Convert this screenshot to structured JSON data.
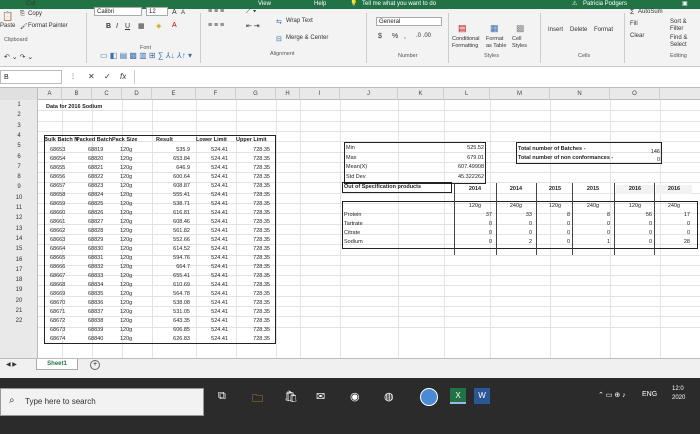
{
  "ribbon": {
    "tabs": [
      "View",
      "Help",
      "Tell me what you want to do"
    ],
    "user": "Patricia Podgers",
    "clipboard": {
      "cut": "Cut",
      "copy": "Copy",
      "paste": "Paste",
      "format_painter": "Format Painter",
      "label": "Clipboard"
    },
    "font": {
      "name": "Calibri",
      "size": "12",
      "label": "Font",
      "grow": "A",
      "shrink": "A",
      "bold": "B",
      "italic": "I",
      "underline": "U"
    },
    "alignment": {
      "wrap": "Wrap Text",
      "merge": "Merge & Center",
      "label": "Alignment"
    },
    "number": {
      "format": "General",
      "currency": "$",
      "percent": "%",
      "comma": ",",
      "label": "Number"
    },
    "styles": {
      "conditional": "Conditional Formatting",
      "format_table": "Format as Table",
      "cell_styles": "Cell Styles",
      "label": "Styles"
    },
    "cells": {
      "insert": "Insert",
      "delete": "Delete",
      "format": "Format",
      "label": "Cells"
    },
    "editing": {
      "autosum": "AutoSum",
      "fill": "Fill",
      "clear": "Clear",
      "sort": "Sort & Filter",
      "find": "Find & Select",
      "label": "Editing"
    }
  },
  "formula_bar": {
    "name_box": "B",
    "cancel": "✕",
    "enter": "✓",
    "fx": "fx",
    "value": ""
  },
  "columns": [
    "A",
    "B",
    "C",
    "D",
    "E",
    "F",
    "G",
    "H",
    "I",
    "J",
    "K",
    "L",
    "M",
    "N",
    "O"
  ],
  "rows": [
    "1",
    "2",
    "3",
    "4",
    "5",
    "6",
    "7",
    "8",
    "9",
    "10",
    "11",
    "12",
    "13",
    "14",
    "15",
    "16",
    "17",
    "18",
    "19",
    "20",
    "21",
    "22"
  ],
  "sheet": {
    "title": "Data for 2016 Sodium",
    "headers": [
      "Bulk Batch No.",
      "Packed Batch",
      "Pack Size",
      "Result",
      "Lower Limit",
      "Upper Limit"
    ],
    "bulk_batch": [
      "68653",
      "68654",
      "68655",
      "68656",
      "68657",
      "68658",
      "68659",
      "68660",
      "68661",
      "68662",
      "68663",
      "68664",
      "68665",
      "68666",
      "68667",
      "68668",
      "68669",
      "68670",
      "68671",
      "68672",
      "68673",
      "68674"
    ],
    "packed_batch": [
      "68819",
      "68820",
      "68821",
      "68822",
      "68823",
      "68824",
      "68825",
      "68826",
      "68827",
      "68828",
      "68829",
      "68830",
      "68831",
      "68832",
      "68833",
      "68834",
      "68835",
      "68836",
      "68837",
      "68838",
      "68839",
      "68840"
    ],
    "pack_size": [
      "120g",
      "120g",
      "120g",
      "120g",
      "120g",
      "120g",
      "120g",
      "120g",
      "120g",
      "120g",
      "120g",
      "120g",
      "120g",
      "120g",
      "120g",
      "120g",
      "120g",
      "120g",
      "120g",
      "120g",
      "120g",
      "120g"
    ],
    "result": [
      "535.9",
      "653.84",
      "646.9",
      "600.64",
      "608.87",
      "555.41",
      "538.71",
      "616.81",
      "608.46",
      "561.82",
      "552.66",
      "614.52",
      "594.76",
      "664.7",
      "655.41",
      "610.69",
      "564.78",
      "538.08",
      "531.05",
      "643.35",
      "606.85",
      "626.83"
    ],
    "lower_limit": [
      "524.41",
      "524.41",
      "524.41",
      "524.41",
      "524.41",
      "524.41",
      "524.41",
      "524.41",
      "524.41",
      "524.41",
      "524.41",
      "524.41",
      "524.41",
      "524.41",
      "524.41",
      "524.41",
      "524.41",
      "524.41",
      "524.41",
      "524.41",
      "524.41",
      "524.41"
    ],
    "upper_limit": [
      "728.35",
      "728.35",
      "728.35",
      "728.35",
      "728.35",
      "728.35",
      "728.35",
      "728.35",
      "728.35",
      "728.35",
      "728.35",
      "728.35",
      "728.35",
      "728.35",
      "728.35",
      "728.35",
      "728.35",
      "728.35",
      "728.35",
      "728.35",
      "728.35",
      "728.35"
    ],
    "stats_labels": [
      "Min",
      "Max",
      "Mean(X)",
      "Std Dev"
    ],
    "stats_values": [
      "525.52",
      "679.01",
      "607.49908",
      "45.322262"
    ],
    "summary_labels": [
      "Total number of Batches -",
      "Total number of non conformances -"
    ],
    "summary_values": [
      "146",
      "0"
    ],
    "oos_label": "Out of Specification products",
    "years": [
      "2014",
      "2014",
      "2015",
      "2015",
      "2016",
      "2016"
    ],
    "pack_sizes": [
      "120g",
      "240g",
      "120g",
      "240g",
      "120g",
      "240g"
    ],
    "params": [
      "Protein",
      "Tartrate",
      "Citrate",
      "Sodium"
    ],
    "oos_values": [
      [
        "37",
        "33",
        "8",
        "8",
        "56",
        "17"
      ],
      [
        "0",
        "0",
        "0",
        "0",
        "0",
        "0"
      ],
      [
        "0",
        "0",
        "0",
        "0",
        "0",
        "0"
      ],
      [
        "0",
        "2",
        "0",
        "1",
        "0",
        "28"
      ]
    ]
  },
  "sheet_tabs": {
    "active": "Sheet1",
    "add": "+"
  },
  "taskbar": {
    "search_placeholder": "Type here to search",
    "lang": "ENG",
    "time": "12:0",
    "date": "2020"
  }
}
